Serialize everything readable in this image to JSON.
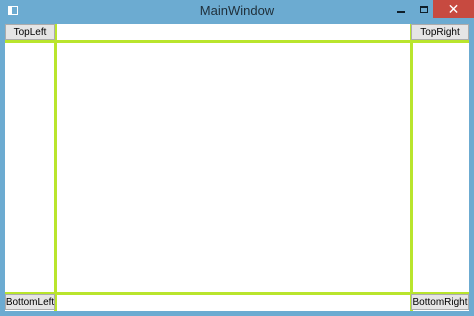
{
  "window": {
    "title": "MainWindow",
    "icons": {
      "app": "app-icon",
      "minimize": "minimize-icon",
      "maximize": "maximize-icon",
      "close": "close-icon"
    },
    "colors": {
      "frame": "#6cabd1",
      "close_button": "#c74a40",
      "grid_lines": "#b9e52d"
    }
  },
  "buttons": {
    "top_left": "TopLeft",
    "top_right": "TopRight",
    "bottom_left": "BottomLeft",
    "bottom_right": "BottomRight"
  }
}
